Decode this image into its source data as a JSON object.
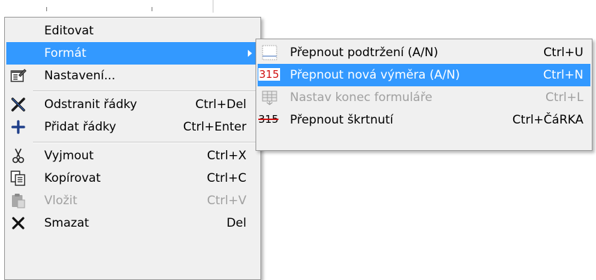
{
  "main_menu": {
    "editovat": "Editovat",
    "format": "Formát",
    "nastaveni": "Nastavení...",
    "odstranit": {
      "label": "Odstranit řádky",
      "shortcut": "Ctrl+Del"
    },
    "pridat": {
      "label": "Přidat řádky",
      "shortcut": "Ctrl+Enter"
    },
    "vyjmout": {
      "label": "Vyjmout",
      "shortcut": "Ctrl+X"
    },
    "kopirovat": {
      "label": "Kopírovat",
      "shortcut": "Ctrl+C"
    },
    "vlozit": {
      "label": "Vložit",
      "shortcut": "Ctrl+V"
    },
    "smazat": {
      "label": "Smazat",
      "shortcut": "Del"
    }
  },
  "submenu": {
    "podtrzeni": {
      "label": "Přepnout podtržení (A/N)",
      "shortcut": "Ctrl+U"
    },
    "nova_vymera": {
      "icon_text": "315",
      "label": "Přepnout nová výměra (A/N)",
      "shortcut": "Ctrl+N"
    },
    "konec_formulare": {
      "label": "Nastav konec formuláře",
      "shortcut": "Ctrl+L"
    },
    "skrtnuti": {
      "icon_text": "315",
      "label": "Přepnout škrtnutí",
      "shortcut": "Ctrl+ČáRKA"
    }
  },
  "colors": {
    "highlight": "#3399ff",
    "menu_bg": "#f0f0f0",
    "disabled": "#a0a0a0",
    "icon_red": "#d01010"
  }
}
